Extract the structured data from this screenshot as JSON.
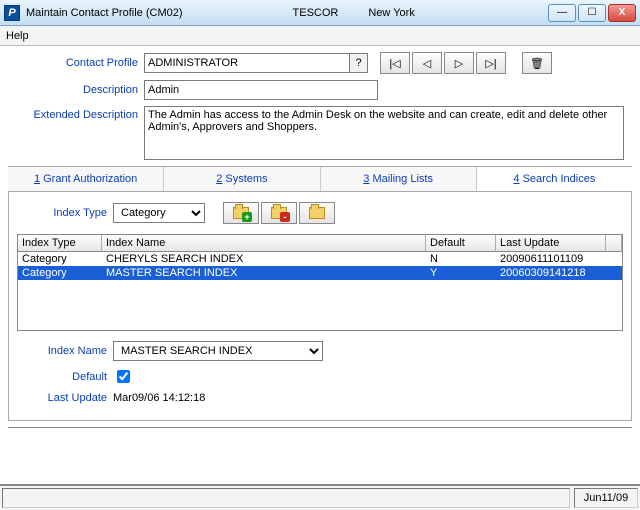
{
  "window": {
    "icon": "P",
    "title": "Maintain Contact Profile (CM02)",
    "company": "TESCOR",
    "location": "New York"
  },
  "menu": {
    "help": "Help"
  },
  "labels": {
    "contact_profile": "Contact Profile",
    "description": "Description",
    "extended_description": "Extended Description",
    "index_type": "Index Type",
    "index_name": "Index Name",
    "default": "Default",
    "last_update": "Last Update"
  },
  "fields": {
    "contact_profile": "ADMINISTRATOR",
    "help_q": "?",
    "description": "Admin",
    "extended_description": "The Admin has access to the Admin Desk on the website and can create, edit and delete other Admin's, Approvers and Shoppers.",
    "index_type_selected": "Category",
    "index_name_selected": "MASTER SEARCH INDEX",
    "default_checked": true,
    "last_update_value": "Mar09/06 14:12:18"
  },
  "tabs": [
    {
      "hotkey": "1",
      "label": " Grant Authorization"
    },
    {
      "hotkey": "2",
      "label": " Systems"
    },
    {
      "hotkey": "3",
      "label": " Mailing Lists"
    },
    {
      "hotkey": "4",
      "label": " Search Indices"
    }
  ],
  "grid": {
    "headers": {
      "index_type": "Index Type",
      "index_name": "Index Name",
      "default": "Default",
      "last_update": "Last Update"
    },
    "rows": [
      {
        "index_type": "Category",
        "index_name": "CHERYLS SEARCH INDEX",
        "default": "N",
        "last_update": "20090611101109",
        "selected": false
      },
      {
        "index_type": "Category",
        "index_name": "MASTER SEARCH INDEX",
        "default": "Y",
        "last_update": "20060309141218",
        "selected": true
      }
    ]
  },
  "status": {
    "date": "Jun11/09"
  },
  "icons": {
    "first": "|◁",
    "prev": "◁",
    "next": "▷",
    "last": "▷|",
    "trash": "🗑",
    "min": "—",
    "max": "☐",
    "close": "X"
  }
}
